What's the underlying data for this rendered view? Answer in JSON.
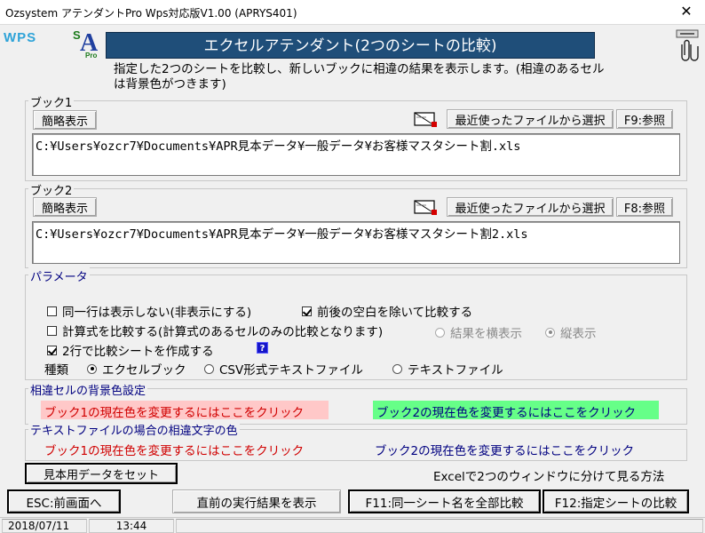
{
  "window": {
    "title": "Ozsystem アテンダントPro Wps対応版V1.00 (APRYS401)",
    "close_glyph": "✕"
  },
  "brand": {
    "wps_logo": "WPS",
    "logo_s": "S",
    "logo_a": "A",
    "logo_pro": "Pro"
  },
  "header": {
    "banner": "エクセルアテンダント(2つのシートの比較)",
    "description": "指定した2つのシートを比較し、新しいブックに相違の結果を表示します。(相違のあるセルは背景色がつきます)"
  },
  "book1": {
    "label": "ブック1",
    "brief_button": "簡略表示",
    "recent_button": "最近使ったファイルから選択",
    "browse_button": "F9:参照",
    "path": "C:¥Users¥ozcr7¥Documents¥APR見本データ¥一般データ¥お客様マスタシート割.xls"
  },
  "book2": {
    "label": "ブック2",
    "brief_button": "簡略表示",
    "recent_button": "最近使ったファイルから選択",
    "browse_button": "F8:参照",
    "path": "C:¥Users¥ozcr7¥Documents¥APR見本データ¥一般データ¥お客様マスタシート割2.xls"
  },
  "params": {
    "label": "パラメータ",
    "hide_same_rows": {
      "label": "同一行は表示しない(非表示にする)",
      "checked": false
    },
    "trim_spaces": {
      "label": "前後の空白を除いて比較する",
      "checked": true
    },
    "compare_formula": {
      "label": "計算式を比較する(計算式のあるセルのみの比較となります)",
      "checked": false
    },
    "horizontal": {
      "label": "結果を横表示",
      "selected": false
    },
    "vertical": {
      "label": "縦表示",
      "selected": true
    },
    "two_rows": {
      "label": "2行で比較シートを作成する",
      "checked": true
    },
    "help_glyph": "?",
    "type_label": "種類",
    "type_excel": {
      "label": "エクセルブック",
      "selected": true
    },
    "type_csv": {
      "label": "CSV形式テキストファイル",
      "selected": false
    },
    "type_text": {
      "label": "テキストファイル",
      "selected": false
    }
  },
  "bg_colors": {
    "label": "相違セルの背景色設定",
    "book1_link": "ブック1の現在色を変更するにはここをクリック",
    "book2_link": "ブック2の現在色を変更するにはここをクリック",
    "book1_color": "#ffc8c8",
    "book2_color": "#66ff88"
  },
  "text_colors": {
    "label": "テキストファイルの場合の相違文字の色",
    "book1_link": "ブック1の現在色を変更するにはここをクリック",
    "book2_link": "ブック2の現在色を変更するにはここをクリック",
    "book1_color": "#d00000",
    "book2_color": "#000080"
  },
  "actions": {
    "sample_data": "見本用データをセット",
    "excel_two_windows": "Excelで2つのウィンドウに分けて見る方法",
    "esc": "ESC:前画面へ",
    "last_result": "直前の実行結果を表示",
    "f11": "F11:同一シート名を全部比較",
    "f12": "F12:指定シートの比較"
  },
  "status": {
    "date": "2018/07/11",
    "time": "13:44"
  }
}
